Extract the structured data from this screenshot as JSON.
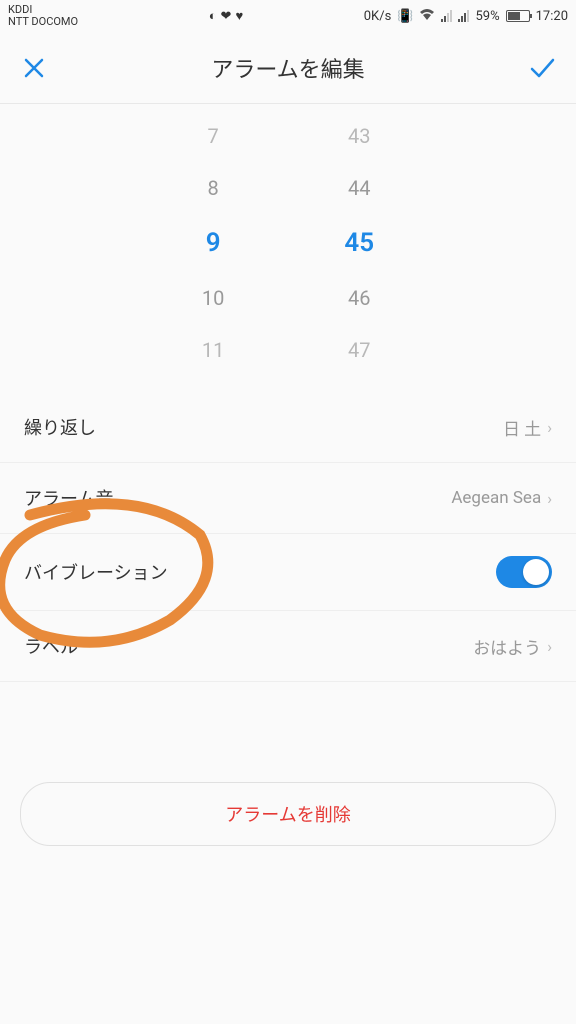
{
  "status": {
    "carrier1": "KDDI",
    "carrier2": "NTT DOCOMO",
    "data_rate": "0K/s",
    "battery_pct": "59%",
    "time": "17:20"
  },
  "header": {
    "title": "アラームを編集"
  },
  "picker": {
    "hours": [
      "7",
      "8",
      "9",
      "10",
      "11"
    ],
    "minutes": [
      "43",
      "44",
      "45",
      "46",
      "47"
    ],
    "selected_index": 2
  },
  "settings": {
    "repeat": {
      "label": "繰り返し",
      "value": "日 土"
    },
    "sound": {
      "label": "アラーム音",
      "value": "Aegean Sea"
    },
    "vibration": {
      "label": "バイブレーション",
      "enabled": true
    },
    "label_row": {
      "label": "ラベル",
      "value": "おはよう"
    }
  },
  "delete_label": "アラームを削除"
}
